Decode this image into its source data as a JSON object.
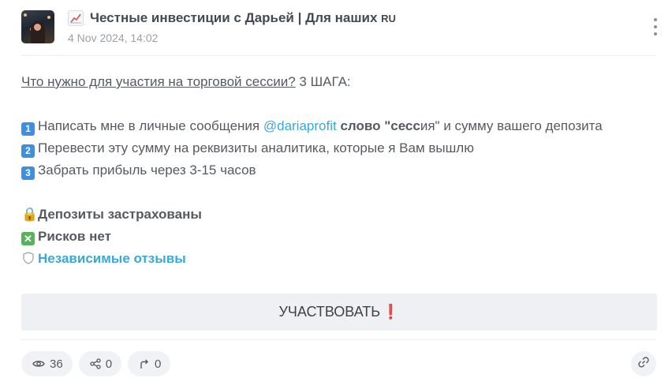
{
  "post": {
    "channel_icon": "chart-increasing-icon",
    "channel_title": "Честные инвестиции с Дарьей | Для наших",
    "channel_suffix": "RU",
    "date": "4 Nov 2024, 14:02"
  },
  "message": {
    "heading_link": "Что нужно для участия на торговой сессии?",
    "heading_rest": " 3 ШАГА:",
    "steps": [
      {
        "key": "1",
        "text_a": "Написать мне в личные сообщения ",
        "mention": "@dariaprofit",
        "bold": " слово \"сесс",
        "text_b": "ия\" и сумму вашего депозита"
      },
      {
        "key": "2",
        "text": "Перевести эту сумму на реквизиты аналитика, которые я Вам вышлю"
      },
      {
        "key": "3",
        "text": "Забрать прибыль через 3-15 часов"
      }
    ],
    "features": [
      {
        "icon": "lock-icon",
        "glyph": "🔒",
        "text": "Депозиты застрахованы"
      },
      {
        "icon": "cross-mark-icon",
        "glyph": "✕",
        "text": "Рисков нет"
      },
      {
        "icon": "shield-icon",
        "glyph": "🛡",
        "text": "Независимые отзывы"
      }
    ]
  },
  "cta": {
    "label": "УЧАСТВОВАТЬ",
    "mark": "❗"
  },
  "footer": {
    "views": "36",
    "shares": "0",
    "forwards": "0"
  }
}
